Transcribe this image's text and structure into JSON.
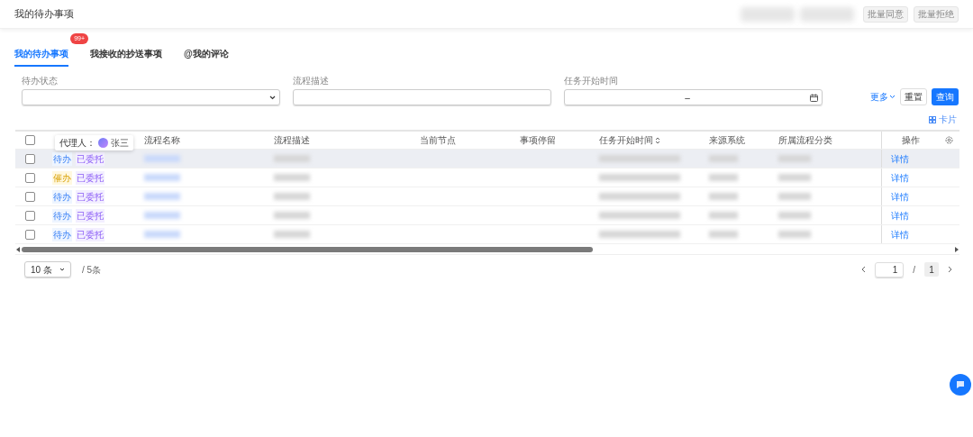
{
  "header": {
    "title": "我的待办事项",
    "buttons": [
      "批量同意",
      "批量拒绝"
    ]
  },
  "tabs": [
    {
      "label": "我的待办事项",
      "selected": true,
      "badge": "99+"
    },
    {
      "label": "我接收的抄送事项",
      "selected": false
    },
    {
      "label": "@我的评论",
      "selected": false
    }
  ],
  "filters": [
    {
      "label": "待办状态",
      "kind": "select"
    },
    {
      "label": "流程描述",
      "kind": "text"
    },
    {
      "label": "任务开始时间",
      "kind": "daterange",
      "separator": "–"
    }
  ],
  "filter_actions": {
    "more": "更多",
    "reset": "重置",
    "query": "查询"
  },
  "view_toggle": "卡片",
  "table": {
    "header_checked": false,
    "columns": [
      {
        "label": "流程名称",
        "kind": "redacted"
      },
      {
        "label": "流程描述",
        "kind": "redacted"
      },
      {
        "label": "当前节点",
        "kind": "empty"
      },
      {
        "label": "事项停留",
        "kind": "empty"
      },
      {
        "label": "任务开始时间",
        "kind": "redacted",
        "sortable": true
      },
      {
        "label": "来源系统",
        "kind": "redacted"
      },
      {
        "label": "所属流程分类",
        "kind": "redacted"
      },
      {
        "label": "操作",
        "kind": "action"
      }
    ],
    "tooltip": {
      "label": "代理人：",
      "name": "张三"
    },
    "rows": [
      {
        "checked": false,
        "hovered": true,
        "status": {
          "label": "待办",
          "kind": "pending"
        },
        "tag": "已委托",
        "action": "详情"
      },
      {
        "checked": false,
        "hovered": false,
        "status": {
          "label": "催办",
          "kind": "urge"
        },
        "tag": "已委托",
        "action": "详情"
      },
      {
        "checked": false,
        "hovered": false,
        "status": {
          "label": "待办",
          "kind": "pending"
        },
        "tag": "已委托",
        "action": "详情"
      },
      {
        "checked": false,
        "hovered": false,
        "status": {
          "label": "待办",
          "kind": "pending"
        },
        "tag": "已委托",
        "action": "详情"
      },
      {
        "checked": false,
        "hovered": false,
        "status": {
          "label": "待办",
          "kind": "pending"
        },
        "tag": "已委托",
        "action": "详情"
      }
    ]
  },
  "pagination": {
    "page_size": "10 条",
    "total": "/ 5条",
    "page": "1",
    "separator": "/",
    "pages": "1"
  }
}
